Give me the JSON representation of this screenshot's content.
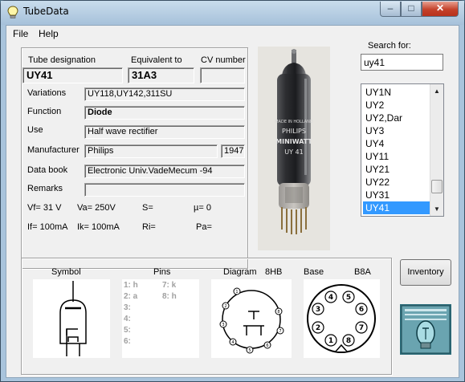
{
  "window": {
    "title": "TubeData"
  },
  "menu": {
    "file": "File",
    "help": "Help"
  },
  "designation": {
    "tube_label": "Tube designation",
    "equiv_label": "Equivalent to",
    "cv_label": "CV number",
    "tube_value": "UY41",
    "equiv_value": "31A3",
    "cv_value": ""
  },
  "details": {
    "variations_label": "Variations",
    "variations_value": "UY118,UY142,311SU",
    "function_label": "Function",
    "function_value": "Diode",
    "use_label": "Use",
    "use_value": "Half wave rectifier",
    "manufacturer_label": "Manufacturer",
    "manufacturer_value": "Philips",
    "year_value": "1947",
    "databook_label": "Data book",
    "databook_value": "Electronic Univ.VadeMecum -94",
    "remarks_label": "Remarks",
    "remarks_value": ""
  },
  "params": {
    "vf": "Vf= 31 V",
    "va": "Va=  250V",
    "s": "S=",
    "mu": "µ=   0",
    "if": "If= 100mA",
    "ik": "Ik=   100mA",
    "ri": "Ri=",
    "pa": "Pa="
  },
  "search": {
    "label": "Search for:",
    "value": "uy41"
  },
  "tube_list": {
    "items": [
      "UY1N",
      "UY2",
      "UY2,Dar",
      "UY3",
      "UY4",
      "UY11",
      "UY21",
      "UY22",
      "UY31",
      "UY41"
    ],
    "selected": "UY41"
  },
  "photo_print": {
    "line1": "MADE IN HOLLAND",
    "line2": "PHILIPS",
    "line3": "MINIWATT",
    "line4": "UY 41"
  },
  "bottom": {
    "symbol_label": "Symbol",
    "pins_label": "Pins",
    "diagram_label": "Diagram",
    "diagram_code": "8HB",
    "base_label": "Base",
    "base_code": "B8A",
    "pins_col1": "1: h\n2: a\n3:\n4:\n5:\n6:",
    "pins_col2": "7: k\n8: h",
    "inventory_button": "Inventory"
  },
  "colors": {
    "selection": "#3399ff",
    "window_frame": "#a9c4dc",
    "close_button": "#c4412a"
  }
}
